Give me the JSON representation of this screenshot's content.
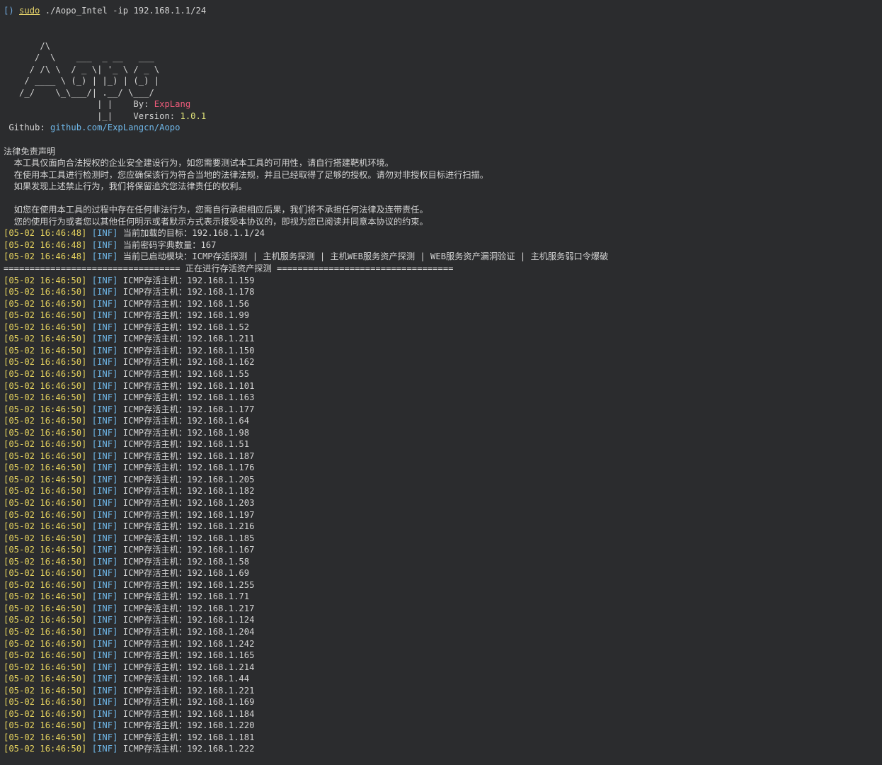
{
  "prompt": {
    "marker": "[)",
    "sudo": "sudo",
    "command": " ./Aopo_Intel -ip 192.168.1.1/24"
  },
  "banner": {
    "ascii_lines": [
      "       /\\",
      "      /  \\    ___  _ __   ___",
      "     / /\\ \\  / _ \\| '_ \\ / _ \\",
      "    / ____ \\ (_) | |_) | (_) |",
      "   /_/    \\_\\___/| .__/ \\___/",
      "                  | |    By: ",
      "                  |_|    Version: "
    ],
    "author": "ExpLang",
    "version": "1.0.1",
    "github_label": " Github: ",
    "github_link": "github.com/ExpLangcn/Aopo"
  },
  "disclaimer": {
    "title": "法律免责声明",
    "lines": [
      "  本工具仅面向合法授权的企业安全建设行为，如您需要测试本工具的可用性，请自行搭建靶机环境。",
      "  在使用本工具进行检测时，您应确保该行为符合当地的法律法规，并且已经取得了足够的授权。请勿对非授权目标进行扫描。",
      "  如果发现上述禁止行为，我们将保留追究您法律责任的权利。",
      "",
      "  如您在使用本工具的过程中存在任何非法行为，您需自行承担相应后果，我们将不承担任何法律及连带责任。",
      "  您的使用行为或者您以其他任何明示或者默示方式表示接受本协议的，即视为您已阅读并同意本协议的约束。"
    ]
  },
  "info_logs": [
    {
      "ts": "[05-02 16:46:48]",
      "level": "[INF]",
      "msg": " 当前加载的目标：192.168.1.1/24"
    },
    {
      "ts": "[05-02 16:46:48]",
      "level": "[INF]",
      "msg": " 当前密码字典数量：167"
    },
    {
      "ts": "[05-02 16:46:48]",
      "level": "[INF]",
      "msg": " 当前已启动模块：ICMP存活探测 | 主机服务探测 | 主机WEB服务资产探测 | WEB服务资产漏洞验证 | 主机服务弱口令爆破"
    }
  ],
  "separator": "================================== 正在进行存活资产探测 ==================================",
  "host_log": {
    "ts": "[05-02 16:46:50]",
    "level": "[INF]",
    "prefix": " ICMP存活主机：",
    "hosts": [
      "192.168.1.159",
      "192.168.1.178",
      "192.168.1.56",
      "192.168.1.99",
      "192.168.1.52",
      "192.168.1.211",
      "192.168.1.150",
      "192.168.1.162",
      "192.168.1.55",
      "192.168.1.101",
      "192.168.1.163",
      "192.168.1.177",
      "192.168.1.64",
      "192.168.1.98",
      "192.168.1.51",
      "192.168.1.187",
      "192.168.1.176",
      "192.168.1.205",
      "192.168.1.182",
      "192.168.1.203",
      "192.168.1.197",
      "192.168.1.216",
      "192.168.1.185",
      "192.168.1.167",
      "192.168.1.58",
      "192.168.1.69",
      "192.168.1.255",
      "192.168.1.71",
      "192.168.1.217",
      "192.168.1.124",
      "192.168.1.204",
      "192.168.1.242",
      "192.168.1.165",
      "192.168.1.214",
      "192.168.1.44",
      "192.168.1.221",
      "192.168.1.169",
      "192.168.1.184",
      "192.168.1.220",
      "192.168.1.181",
      "192.168.1.222"
    ]
  },
  "colors": {
    "background": "#2b2c2e",
    "text": "#d4d4d4",
    "timestamp": "#e6d35e",
    "level": "#6fb7e8",
    "author": "#ef5b7b",
    "version": "#dfe37a",
    "link": "#6fb7e8"
  }
}
